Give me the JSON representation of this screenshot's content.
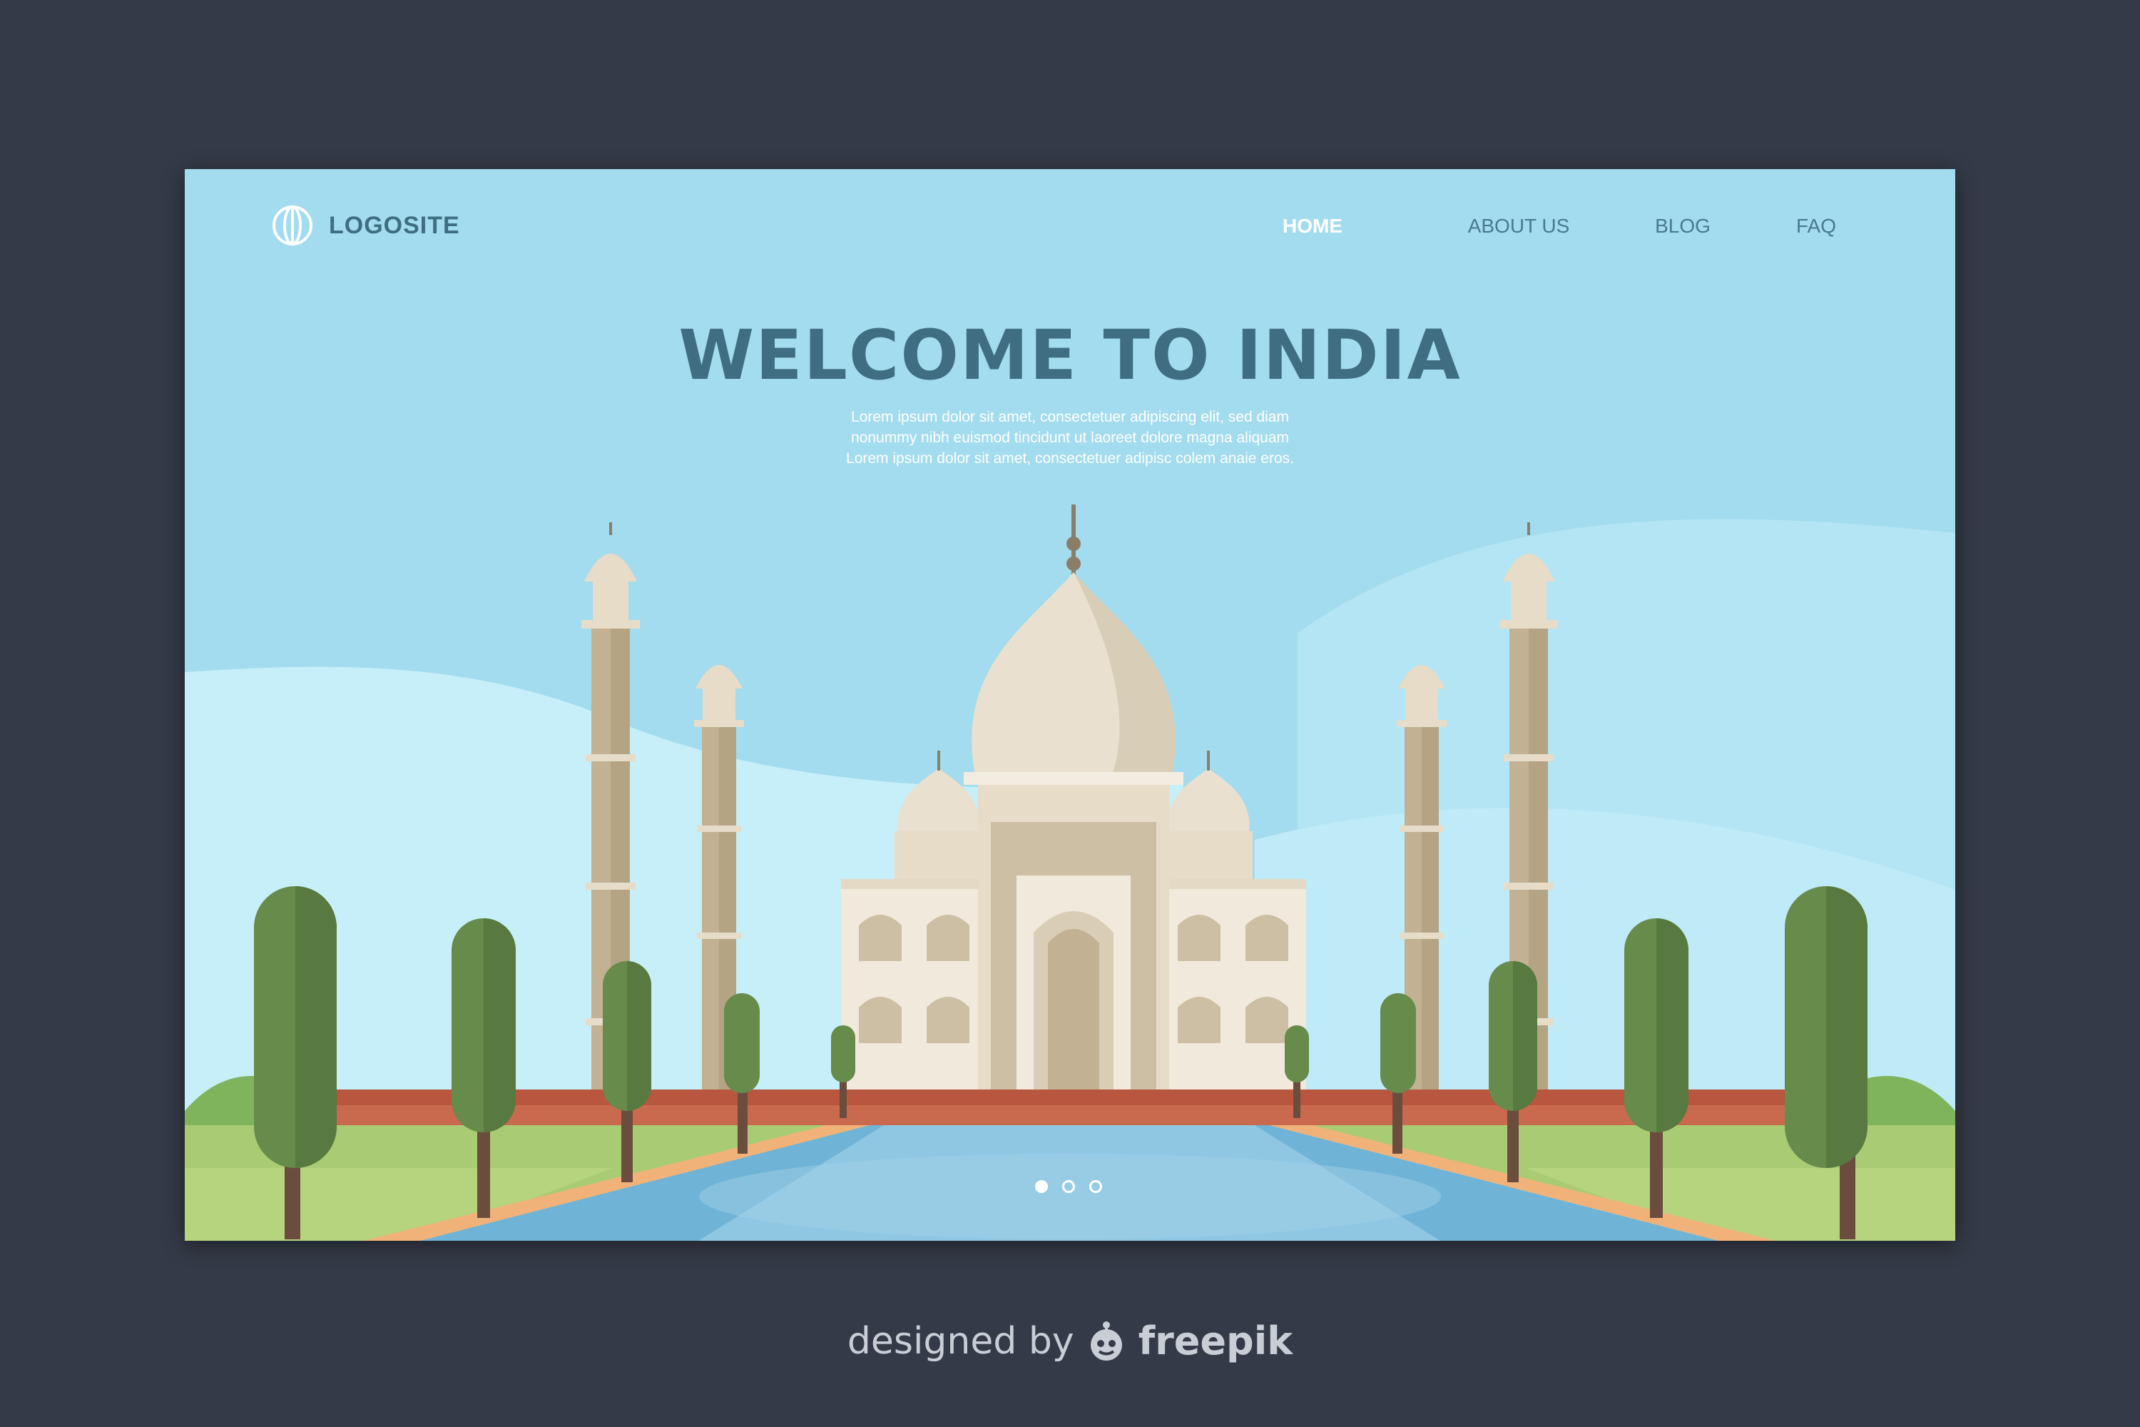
{
  "logo": {
    "icon": "globe-icon",
    "text": "LOGOSITE"
  },
  "nav": [
    {
      "label": "HOME",
      "active": true
    },
    {
      "label": "ABOUT US",
      "active": false
    },
    {
      "label": "BLOG",
      "active": false
    },
    {
      "label": "FAQ",
      "active": false
    }
  ],
  "hero": {
    "title": "WELCOME TO INDIA",
    "subtitle_lines": [
      "Lorem ipsum dolor sit amet, consectetuer adipiscing elit, sed diam",
      "nonummy nibh euismod tincidunt ut laoreet dolore magna aliquam",
      "Lorem ipsum dolor sit amet, consectetuer adipisc colem anaie eros."
    ]
  },
  "slider": {
    "count": 3,
    "active_index": 0
  },
  "illustration": {
    "subject": "taj-mahal",
    "colors": {
      "sky": "#a3dcee",
      "marble": "#e9e0cf",
      "tree": "#668b4b",
      "water": "#6fb3d6",
      "wall": "#c96a4e"
    }
  },
  "credit": {
    "prefix": "designed by",
    "brand": "freepik",
    "icon": "freepik-mascot-icon"
  }
}
